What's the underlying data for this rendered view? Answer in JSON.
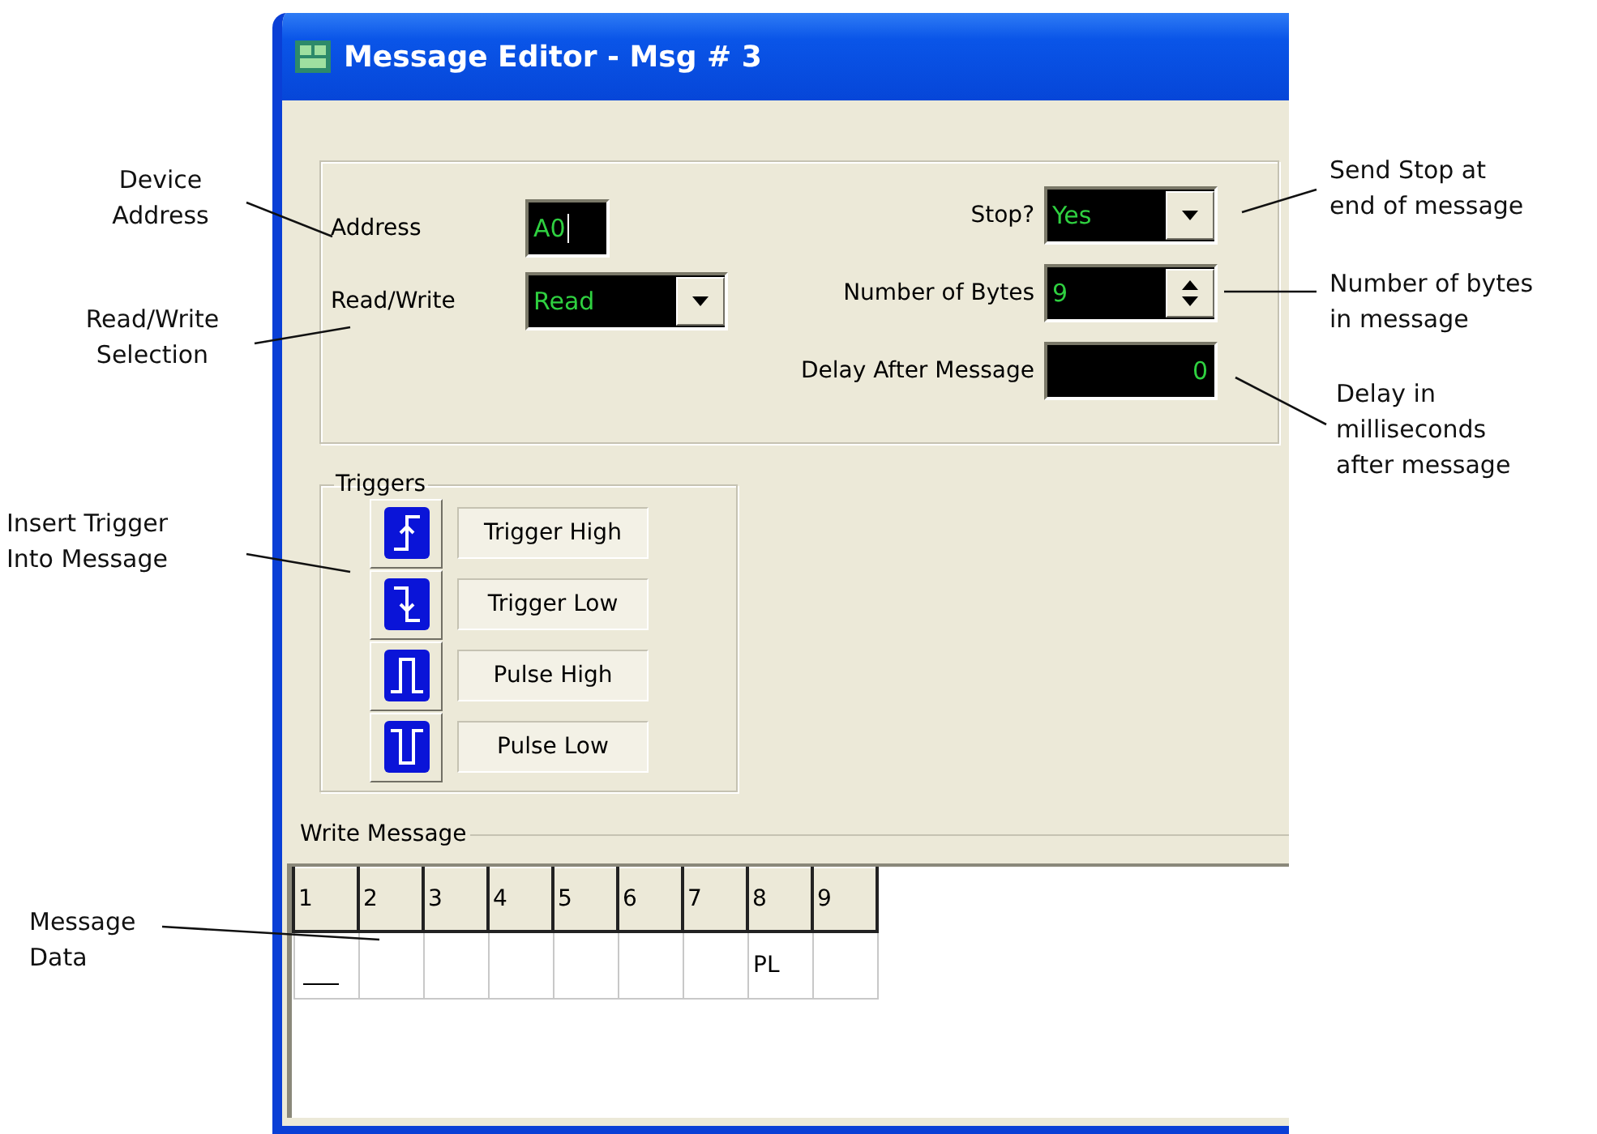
{
  "window": {
    "title": "Message Editor - Msg # 3"
  },
  "settings": {
    "address": {
      "label": "Address",
      "value": "A0"
    },
    "read_write": {
      "label": "Read/Write",
      "value": "Read"
    },
    "stop": {
      "label": "Stop?",
      "value": "Yes"
    },
    "bytes": {
      "label": "Number of Bytes",
      "value": "9"
    },
    "delay": {
      "label": "Delay After Message",
      "value": "0"
    }
  },
  "triggers": {
    "title": "Triggers",
    "items": [
      {
        "kind": "rise",
        "label": "Trigger High"
      },
      {
        "kind": "fall",
        "label": "Trigger Low"
      },
      {
        "kind": "pulse_high",
        "label": "Pulse High"
      },
      {
        "kind": "pulse_low",
        "label": "Pulse Low"
      }
    ]
  },
  "write_message": {
    "title": "Write Message",
    "columns": [
      "1",
      "2",
      "3",
      "4",
      "5",
      "6",
      "7",
      "8",
      "9"
    ],
    "cells": [
      {
        "cursor": true
      },
      {
        "cursor": false
      },
      {
        "cursor": false
      },
      {
        "cursor": false
      },
      {
        "cursor": false
      },
      {
        "cursor": false
      },
      {
        "cursor": false
      },
      {
        "cursor": false,
        "text": "PL"
      },
      {
        "cursor": false
      }
    ]
  },
  "annotations": [
    {
      "lines": [
        "Device",
        "Address"
      ]
    },
    {
      "lines": [
        "Read/Write",
        "Selection"
      ]
    },
    {
      "lines": [
        "Insert Trigger",
        "Into Message"
      ]
    },
    {
      "lines": [
        "Message",
        "Data"
      ]
    },
    {
      "lines": [
        "Send Stop at",
        "end of message"
      ]
    },
    {
      "lines": [
        "Number of bytes",
        "in message"
      ]
    },
    {
      "lines": [
        "Delay in",
        "milliseconds",
        "after message"
      ]
    }
  ]
}
